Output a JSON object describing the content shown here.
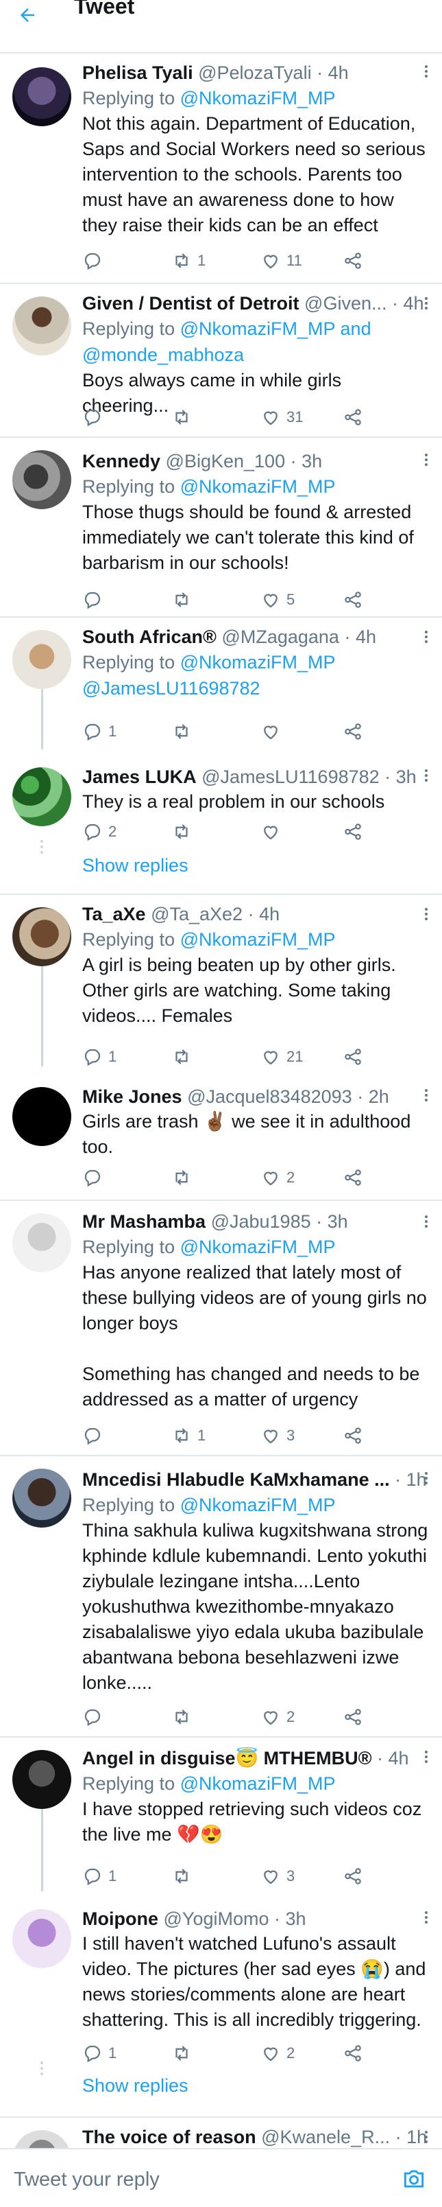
{
  "header": {
    "title": "Tweet"
  },
  "tweets": [
    {
      "name": "Phelisa Tyali",
      "handle": "@PelozaTyali",
      "time": "· 4h",
      "reply_prefix": "Replying to ",
      "reply_to": "@NkomaziFM_MP",
      "text": "Not this again. Department of Education, Saps and Social Workers need so serious intervention to the schools. Parents too must have an awareness done to how they raise their kids can be an effect",
      "retweets": "1",
      "likes": "11"
    },
    {
      "name": "Given / Dentist of Detroit",
      "handle": "@Given...",
      "time": "· 4h",
      "reply_prefix": "Replying to ",
      "reply_to": "@NkomaziFM_MP and @monde_mabhoza",
      "text": "Boys always came in while girls cheering...",
      "retweets": "",
      "likes": "31"
    },
    {
      "name": "Kennedy",
      "handle": "@BigKen_100",
      "time": "· 3h",
      "reply_prefix": "Replying to ",
      "reply_to": "@NkomaziFM_MP",
      "text": "Those thugs should be found & arrested immediately we can't tolerate this kind of barbarism in our schools!",
      "retweets": "",
      "likes": "5"
    },
    {
      "name": "South African®",
      "handle": "@MZagagana",
      "time": "· 4h",
      "reply_prefix": "Replying to ",
      "reply_to": "@NkomaziFM_MP @JamesLU11698782",
      "text": "",
      "replies": "1",
      "retweets": "",
      "likes": ""
    },
    {
      "name": "James LUKA",
      "handle": "@JamesLU11698782",
      "time": "· 3h",
      "text": "They is a real problem in our schools",
      "replies": "2",
      "retweets": "",
      "likes": ""
    },
    {
      "name": "Ta_aXe",
      "handle": "@Ta_aXe2",
      "time": "· 4h",
      "reply_prefix": "Replying to ",
      "reply_to": "@NkomaziFM_MP",
      "text": "A girl is being beaten up by other girls. Other girls are watching. Some taking videos.... Females",
      "replies": "1",
      "retweets": "",
      "likes": "21"
    },
    {
      "name": "Mike Jones",
      "handle": "@Jacquel83482093",
      "time": "· 2h",
      "text": "Girls are trash ✌🏾 we see it in adulthood too.",
      "retweets": "",
      "likes": "2"
    },
    {
      "name": "Mr Mashamba",
      "handle": "@Jabu1985",
      "time": "· 3h",
      "reply_prefix": "Replying to ",
      "reply_to": "@NkomaziFM_MP",
      "text": "Has anyone realized that lately most of these bullying videos are of young girls no longer boys",
      "text2": "Something has changed and needs to be addressed as a matter of urgency",
      "retweets": "1",
      "likes": "3"
    },
    {
      "name": "Mncedisi Hlabudle KaMxhamane ...",
      "handle": "",
      "time": "· 1h",
      "reply_prefix": "Replying to ",
      "reply_to": "@NkomaziFM_MP",
      "text": "Thina sakhula kuliwa kugxitshwana strong kphinde kdlule kubemnandi. Lento yokuthi ziybulale lezingane intsha....Lento yokushuthwa kwezithombe-mnyakazo zisabalaliswe yiyo edala ukuba bazibulale abantwana bebona besehlazweni izwe lonke.....",
      "retweets": "",
      "likes": "2"
    },
    {
      "name": "Angel in disguise😇 MTHEMBU®",
      "handle": "",
      "time": "· 4h",
      "reply_prefix": "Replying to ",
      "reply_to": "@NkomaziFM_MP",
      "text": "I have stopped retrieving such videos coz the live me 💔😍",
      "replies": "1",
      "retweets": "",
      "likes": "3"
    },
    {
      "name": "Moipone",
      "handle": "@YogiMomo",
      "time": "· 3h",
      "text": "I still haven't watched Lufuno's assault video. The pictures (her sad eyes 😭) and news stories/comments alone are heart shattering. This is all incredibly triggering.",
      "replies": "1",
      "retweets": "",
      "likes": "2"
    },
    {
      "name": "The voice of reason",
      "handle": "@Kwanele_R...",
      "time": "· 1h"
    }
  ],
  "show_replies": [
    "Show replies",
    "Show replies"
  ],
  "composer": {
    "placeholder": "Tweet your reply"
  },
  "colors": {
    "accent": "#1da1f2",
    "muted": "#657786",
    "border": "#e1e8ed"
  }
}
